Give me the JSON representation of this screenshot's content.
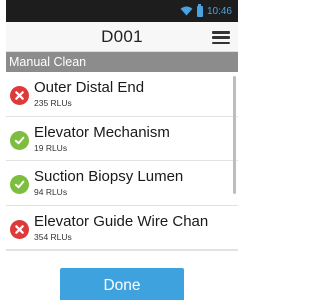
{
  "status_bar": {
    "time": "10:46"
  },
  "header": {
    "title": "D001",
    "menu_icon": "hamburger-menu-icon"
  },
  "section": {
    "label": "Manual Clean"
  },
  "items": [
    {
      "name": "Outer Distal End",
      "rlu": "235 RLUs",
      "status": "fail",
      "icon": "fail-x-icon"
    },
    {
      "name": "Elevator Mechanism",
      "rlu": "19 RLUs",
      "status": "pass",
      "icon": "pass-check-icon"
    },
    {
      "name": "Suction Biopsy Lumen",
      "rlu": "94 RLUs",
      "status": "pass",
      "icon": "pass-check-icon"
    },
    {
      "name": "Elevator Guide Wire Chan",
      "rlu": "354 RLUs",
      "status": "fail",
      "icon": "fail-x-icon"
    }
  ],
  "footer": {
    "done_label": "Done"
  },
  "colors": {
    "fail": "#dd3b3b",
    "pass": "#7dbd3f",
    "accent": "#3ea2de",
    "section_bar": "#8c8c8c"
  }
}
